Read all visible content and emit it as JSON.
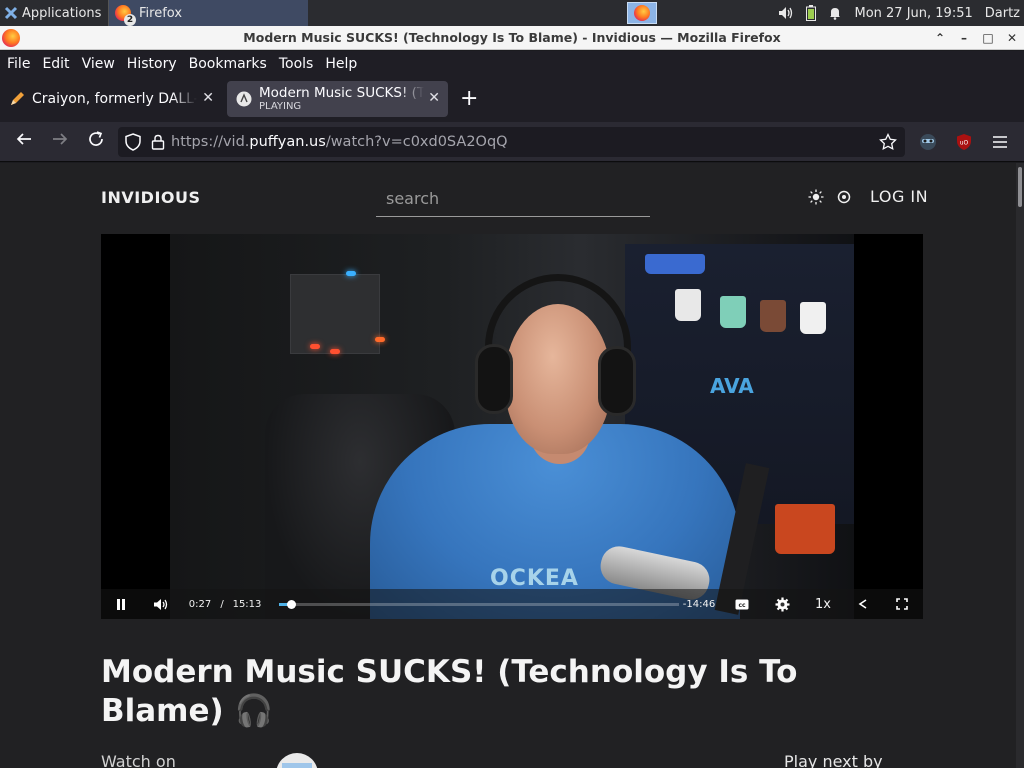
{
  "panel": {
    "applications_label": "Applications",
    "task_label": "Firefox",
    "task_badge": "2",
    "clock": "Mon 27 Jun, 19:51",
    "user": "Dartz"
  },
  "window": {
    "title": "Modern Music SUCKS! (Technology Is To Blame) - Invidious — Mozilla Firefox"
  },
  "menubar": {
    "items": [
      "File",
      "Edit",
      "View",
      "History",
      "Bookmarks",
      "Tools",
      "Help"
    ]
  },
  "tabs": [
    {
      "label": "Craiyon, formerly DALL-E mini",
      "status": ""
    },
    {
      "label": "Modern Music SUCKS! (Technology Is To Blame)",
      "status": "PLAYING"
    }
  ],
  "urlbar": {
    "prefix": "https://vid.",
    "domain": "puffyan.us",
    "path": "/watch?v=c0xd0SA2OqQ"
  },
  "site": {
    "brand": "INVIDIOUS",
    "search_placeholder": "search",
    "login_label": "LOG IN"
  },
  "player": {
    "current_time": "0:27",
    "separator": "/",
    "duration": "15:13",
    "remaining": "-14:46",
    "speed": "1x",
    "progress": 0.03,
    "shirt_text": "OCKEA",
    "ava_text": "AVA"
  },
  "video": {
    "title": "Modern Music SUCKS! (Technology Is To Blame) 🎧",
    "watch_on_label": "Watch on",
    "play_next_label": "Play next by"
  },
  "colors": {
    "accent": "#4fb2e8",
    "page_bg": "#212123",
    "chrome_bg": "#1f1e25",
    "active_tab": "#42414d"
  }
}
